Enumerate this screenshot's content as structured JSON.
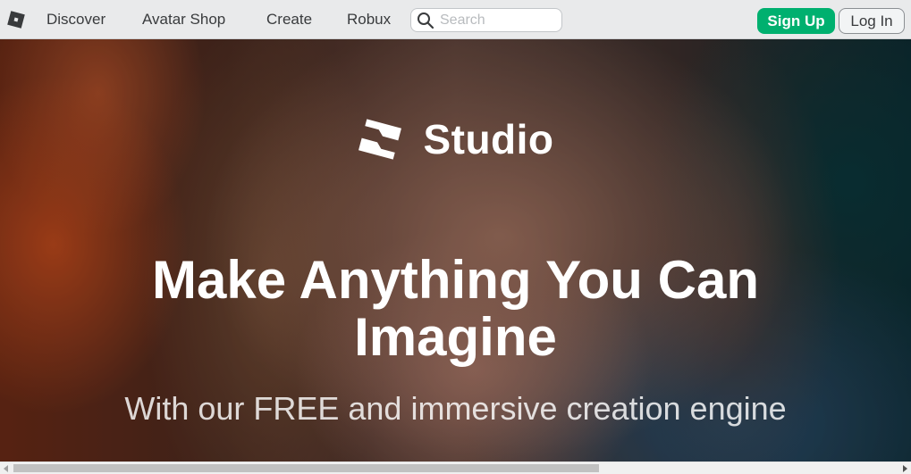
{
  "nav": {
    "links": [
      "Discover",
      "Avatar Shop",
      "Create",
      "Robux"
    ],
    "search_placeholder": "Search",
    "signup_label": "Sign Up",
    "login_label": "Log In"
  },
  "hero": {
    "brand_label": "Studio",
    "headline": "Make Anything You Can Imagine",
    "subheadline": "With our FREE and immersive creation engine"
  },
  "colors": {
    "nav_background": "#e9eaeb",
    "signup_green": "#00b06f",
    "text_dark": "#393b3d"
  },
  "icons": [
    "roblox-logo-icon",
    "search-icon",
    "studio-logo-icon",
    "scroll-left-icon",
    "scroll-right-icon"
  ]
}
